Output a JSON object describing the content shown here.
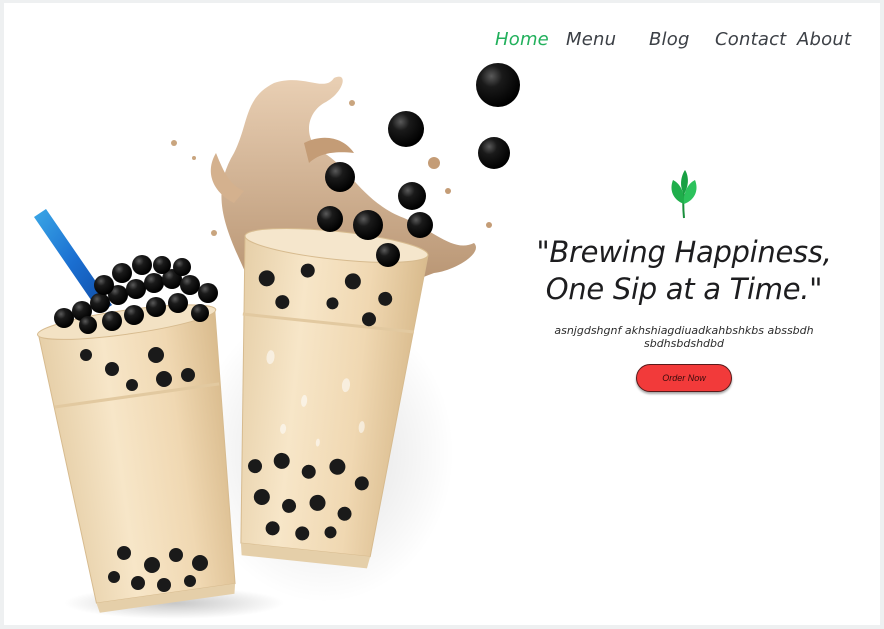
{
  "nav": {
    "items": [
      {
        "label": "Home",
        "active": true
      },
      {
        "label": "Menu",
        "active": false
      },
      {
        "label": "Blog",
        "active": false
      },
      {
        "label": "Contact",
        "active": false
      },
      {
        "label": "About",
        "active": false
      }
    ],
    "active_color": "#22b05c",
    "text_color": "#3c4046"
  },
  "hero": {
    "tagline_line1": "\"Brewing Happiness,",
    "tagline_line2": "One Sip at a Time.\"",
    "subtext": "asnjgdshgnf akhshiagdiuadkahbshkbs abssbdhsbdhsbdshdbd",
    "order_button_label": "Order Now",
    "leaf_icon": "tea-leaf-icon",
    "button_color": "#f23a3a",
    "leaf_color": "#1fae4b"
  },
  "illustration": {
    "subject": "bubble-tea-cups-illustration"
  }
}
